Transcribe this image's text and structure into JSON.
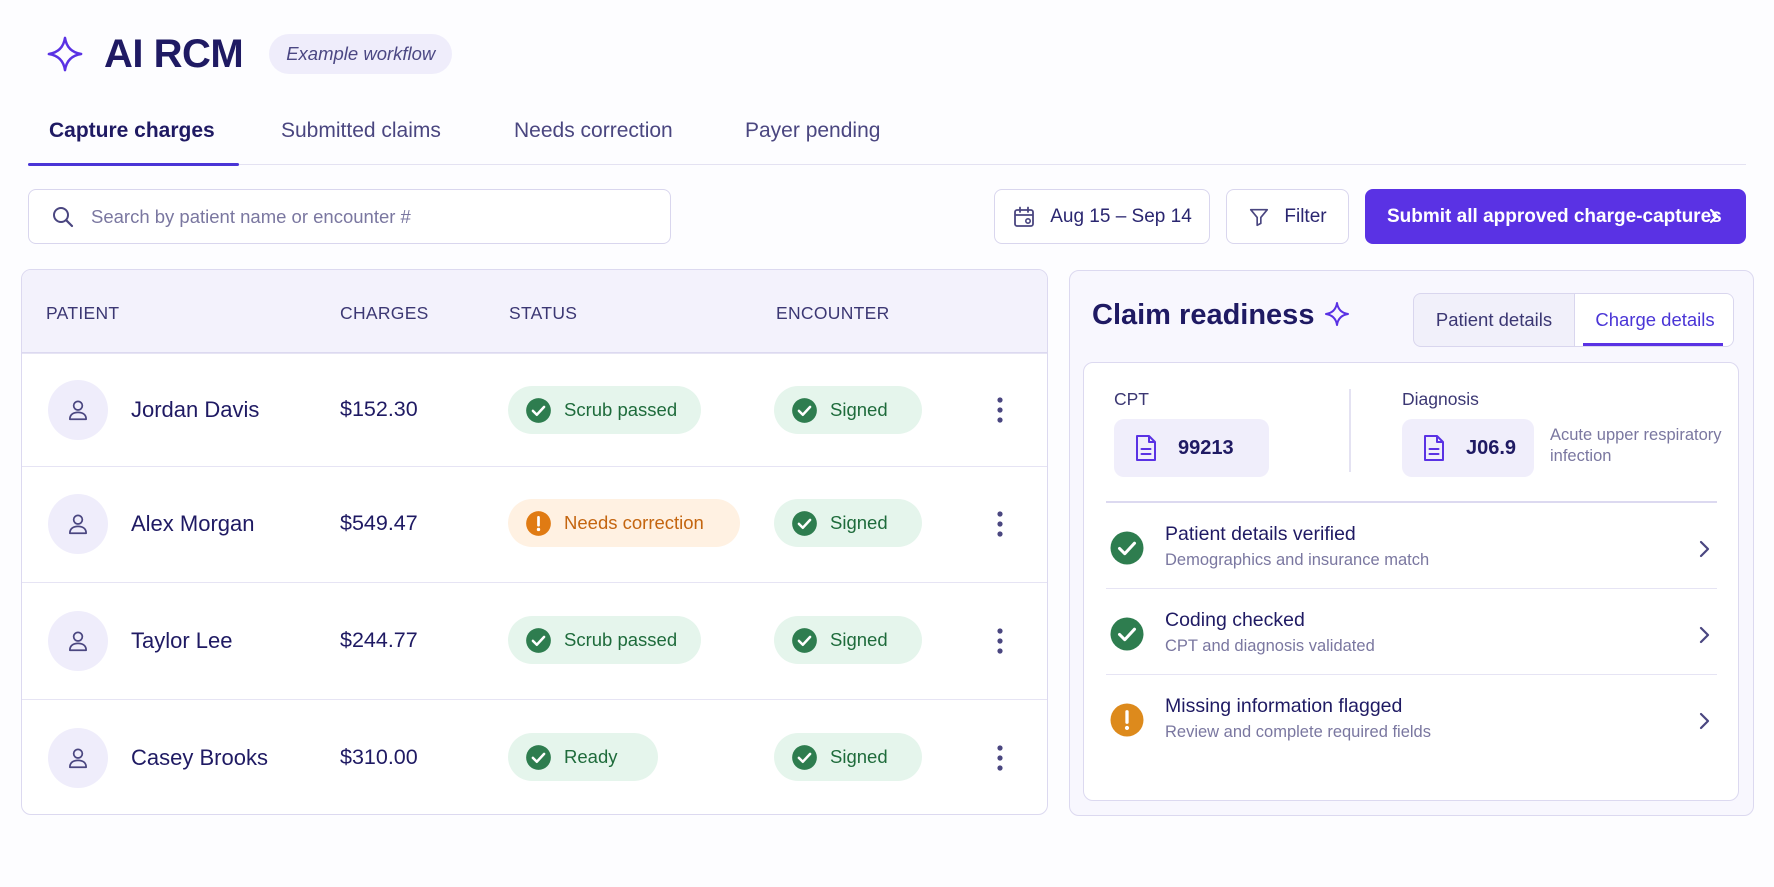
{
  "app": {
    "title": "AI RCM",
    "badge": "Example workflow",
    "brand_color": "#5a32e4"
  },
  "tabs": [
    {
      "label": "Capture charges",
      "active": true
    },
    {
      "label": "Submitted claims",
      "active": false
    },
    {
      "label": "Needs correction",
      "active": false
    },
    {
      "label": "Payer pending",
      "active": false
    }
  ],
  "toolbar": {
    "search_placeholder": "Search by patient name or encounter #",
    "search_icon": "search-icon",
    "date_range": "Aug 15 – Sep 14",
    "date_icon": "calendar-icon",
    "filter_label": "Filter",
    "filter_icon": "filter-icon",
    "submit_label": "Submit all approved charge-captures",
    "submit_icon": "chevron-right-icon"
  },
  "table": {
    "columns": [
      "PATIENT",
      "CHARGES",
      "STATUS",
      "ENCOUNTER"
    ],
    "rows": [
      {
        "name": "Jordan Davis",
        "charge": "$152.30",
        "status": "Scrub passed",
        "status_type": "success",
        "encounter": "Signed"
      },
      {
        "name": "Alex Morgan",
        "charge": "$549.47",
        "status": "Needs correction",
        "status_type": "warning",
        "encounter": "Signed"
      },
      {
        "name": "Taylor Lee",
        "charge": "$244.77",
        "status": "Scrub passed",
        "status_type": "success",
        "encounter": "Signed"
      },
      {
        "name": "Casey Brooks",
        "charge": "$310.00",
        "status": "Ready",
        "status_type": "success",
        "encounter": "Signed"
      }
    ]
  },
  "panel": {
    "title": "Claim readiness",
    "tabs": [
      {
        "label": "Patient details",
        "active": false
      },
      {
        "label": "Charge details",
        "active": true
      }
    ],
    "cpt": {
      "label": "CPT",
      "code": "99213"
    },
    "diagnosis": {
      "label": "Diagnosis",
      "code": "J06.9",
      "description": "Acute upper respiratory infection"
    },
    "checks": [
      {
        "title": "Patient details verified",
        "subtitle": "Demographics and insurance match",
        "status": "success"
      },
      {
        "title": "Coding checked",
        "subtitle": "CPT and diagnosis validated",
        "status": "success"
      },
      {
        "title": "Missing information flagged",
        "subtitle": "Review and complete required fields",
        "status": "warning"
      }
    ]
  },
  "colors": {
    "success": "#2e7d4f",
    "warning": "#e07b13",
    "warning_dark": "#dd8a1c",
    "primary": "#5a32e4"
  }
}
